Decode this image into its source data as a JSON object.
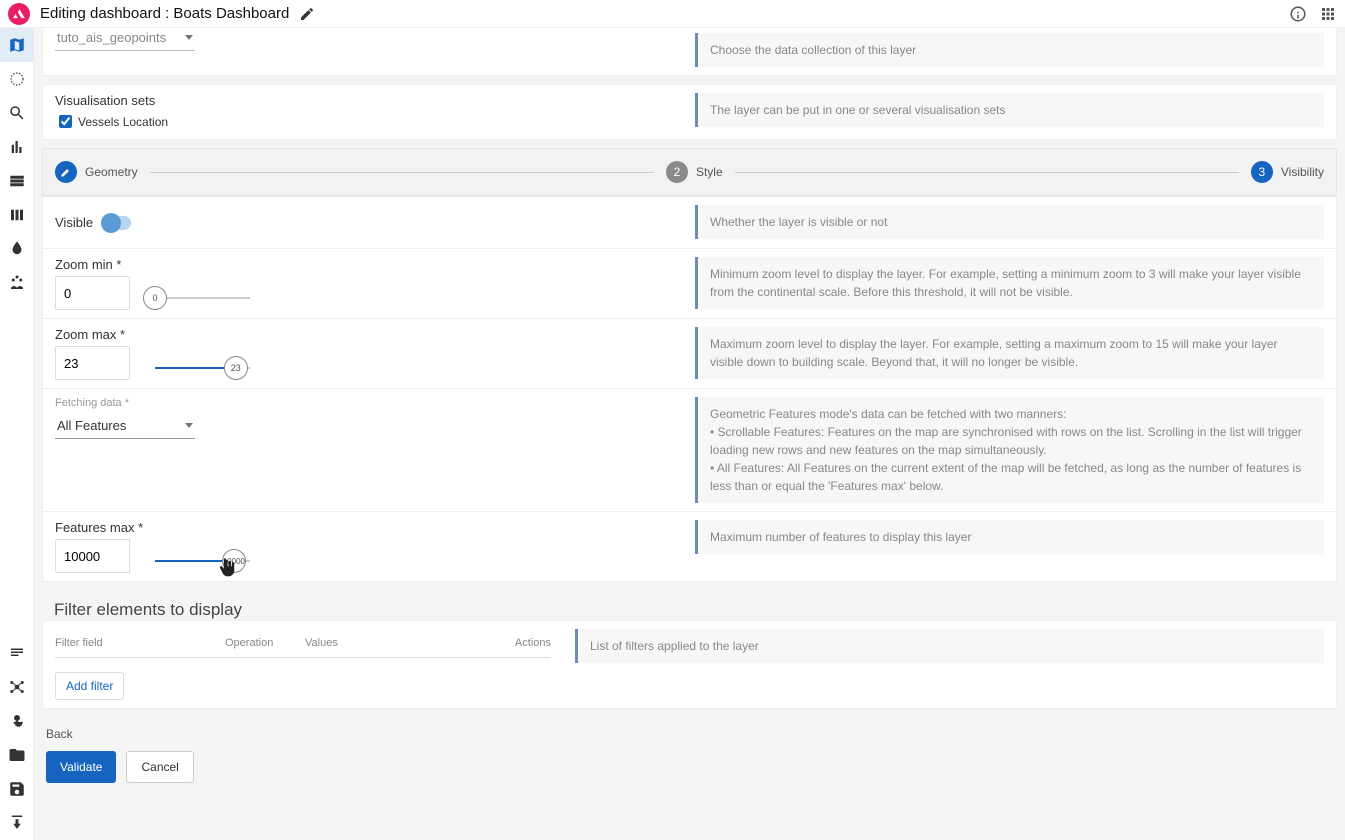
{
  "header": {
    "title": "Editing dashboard : Boats Dashboard"
  },
  "collection": {
    "value": "tuto_ais_geopoints",
    "desc": "Choose the data collection of this layer"
  },
  "vis_sets": {
    "label": "Visualisation sets",
    "item1": "Vessels Location",
    "desc": "The layer can be put in one or several visualisation sets"
  },
  "stepper": {
    "s1": "Geometry",
    "s2": "2",
    "s2_label": "Style",
    "s3": "3",
    "s3_label": "Visibility"
  },
  "visible": {
    "label": "Visible",
    "desc": "Whether the layer is visible or not"
  },
  "zoom_min": {
    "label": "Zoom min *",
    "value": "0",
    "thumb": "0",
    "desc": "Minimum zoom level to display the layer. For example, setting a minimum zoom to 3 will make your layer visible from the continental scale. Before this threshold, it will not be visible."
  },
  "zoom_max": {
    "label": "Zoom max *",
    "value": "23",
    "thumb": "23",
    "desc": "Maximum zoom level to display the layer. For example, setting a maximum zoom to 15 will make your layer visible down to building scale. Beyond that, it will no longer be visible."
  },
  "fetching": {
    "label": "Fetching data *",
    "value": "All Features",
    "desc_line1": "Geometric Features mode's data can be fetched with two manners:",
    "desc_line2": "• Scrollable Features: Features on the map are synchronised with rows on the list. Scrolling in the list will trigger loading new rows and new features on the map simultaneously.",
    "desc_line3": "• All Features: All Features on the current extent of the map will be fetched, as long as the number of features is less than or equal the 'Features max' below."
  },
  "features_max": {
    "label": "Features max *",
    "value": "10000",
    "thumb": "10000",
    "desc": "Maximum number of features to display this layer"
  },
  "filters": {
    "title": "Filter elements to display",
    "col1": "Filter field",
    "col2": "Operation",
    "col3": "Values",
    "col4": "Actions",
    "add": "Add filter",
    "desc": "List of filters applied to the layer"
  },
  "footer": {
    "back": "Back",
    "validate": "Validate",
    "cancel": "Cancel"
  }
}
